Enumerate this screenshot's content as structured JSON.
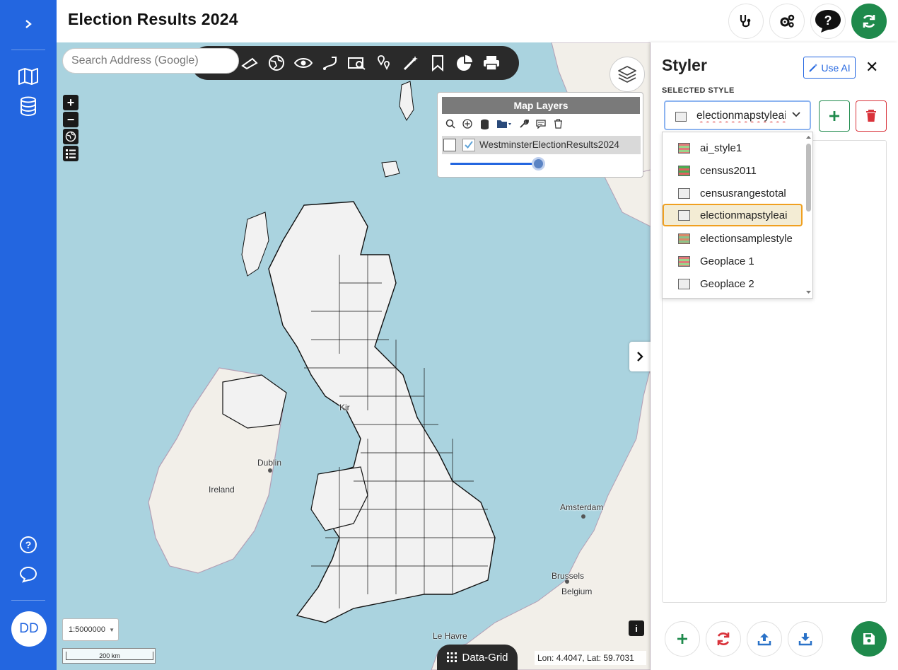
{
  "app": {
    "title": "Election Results 2024"
  },
  "rail": {
    "avatar_initials": "DD"
  },
  "map": {
    "search_placeholder": "Search Address (Google)",
    "labels": {
      "dublin": "Dublin",
      "ireland": "Ireland",
      "amsterdam": "Amsterdam",
      "brussels": "Brussels",
      "belgium": "Belgium",
      "le_havre": "Le Havre",
      "kirk": "Kir"
    },
    "layers_panel": {
      "title": "Map Layers",
      "layer_name": "WestminsterElectionResults2024",
      "opacity": 0.95
    },
    "scale_select": "1:5000000",
    "scale_bar": "200 km",
    "info_label": "i",
    "data_grid_label": "Data-Grid",
    "coordinates": "Lon: 4.4047, Lat: 59.7031"
  },
  "styler": {
    "title": "Styler",
    "use_ai_label": "Use AI",
    "selected_style_label": "SELECTED STYLE",
    "selected_value": "electionmapstyleai",
    "options": [
      {
        "label": "ai_style1",
        "swatch": "striped-red-green"
      },
      {
        "label": "census2011",
        "swatch": "striped-green-red"
      },
      {
        "label": "censusrangestotal",
        "swatch": "plain"
      },
      {
        "label": "electionmapstyleai",
        "swatch": "plain",
        "active": true
      },
      {
        "label": "electionsamplestyle",
        "swatch": "striped-mixed"
      },
      {
        "label": "Geoplace 1",
        "swatch": "striped-red-green"
      },
      {
        "label": "Geoplace 2",
        "swatch": "plain"
      }
    ]
  },
  "colors": {
    "rail": "#2366e0",
    "sea": "#aad3df",
    "land": "#f2efe9",
    "accent_green": "#1f8a4c",
    "danger": "#d9333b",
    "highlight": "#f0a020"
  }
}
